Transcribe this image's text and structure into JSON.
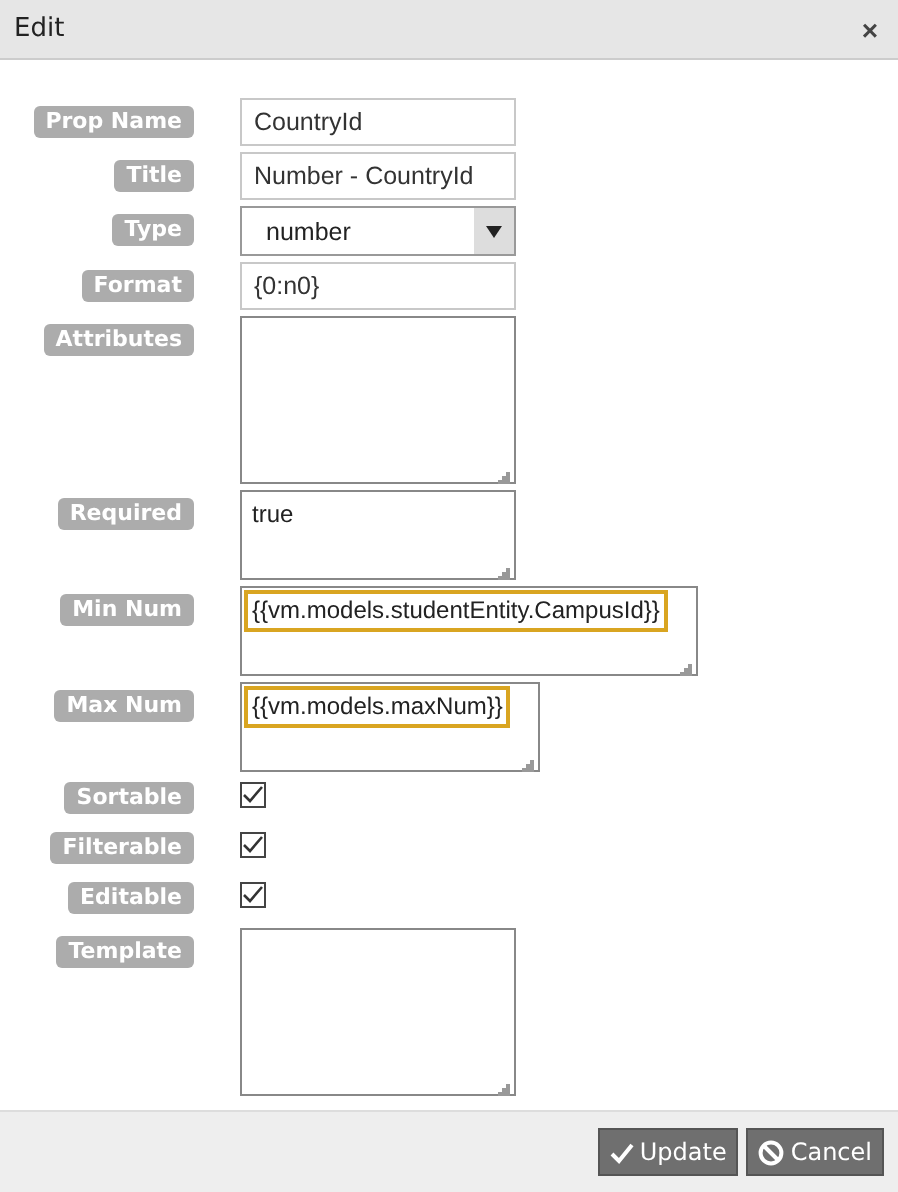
{
  "window": {
    "title": "Edit",
    "close": "×"
  },
  "fields": [
    {
      "label": "Prop Name",
      "kind": "text",
      "value": "CountryId"
    },
    {
      "label": "Title",
      "kind": "text",
      "value": "Number - CountryId"
    },
    {
      "label": "Type",
      "kind": "select",
      "value": "number"
    },
    {
      "label": "Format",
      "kind": "text",
      "value": "{0:n0}"
    },
    {
      "label": "Attributes",
      "kind": "textarea"
    },
    {
      "label": "Required",
      "kind": "textarea",
      "value": "true",
      "highlighted": false
    },
    {
      "label": "Min Num",
      "kind": "textarea",
      "value": "{{vm.models.studentEntity.CampusId}}",
      "highlighted": true
    },
    {
      "label": "Max Num",
      "kind": "textarea",
      "value": "{{vm.models.maxNum}}",
      "highlighted": true
    },
    {
      "label": "Sortable",
      "kind": "checkbox",
      "checked": true
    },
    {
      "label": "Filterable",
      "kind": "checkbox",
      "checked": true
    },
    {
      "label": "Editable",
      "kind": "checkbox",
      "checked": true
    },
    {
      "label": "Template",
      "kind": "textarea"
    }
  ],
  "buttons": [
    {
      "label": "Update"
    },
    {
      "label": "Cancel"
    }
  ]
}
